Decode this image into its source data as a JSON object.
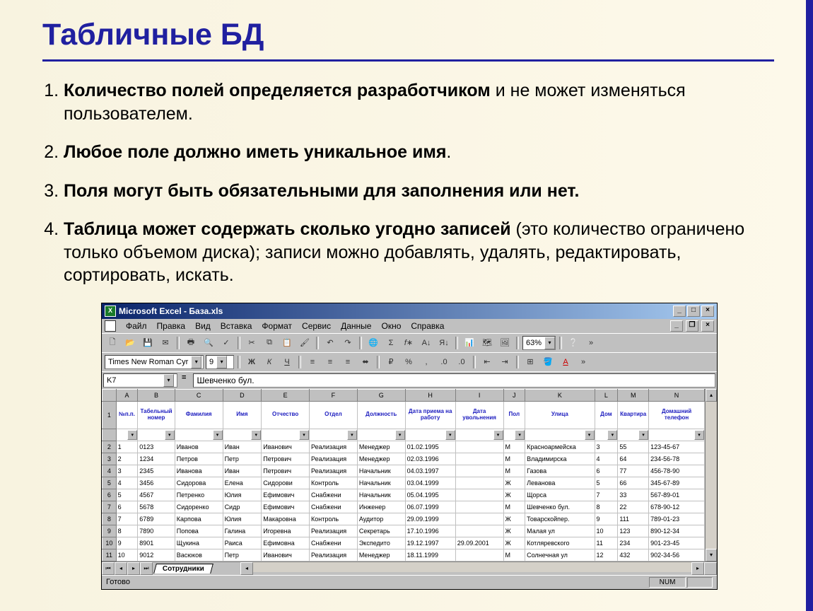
{
  "slide": {
    "title": "Табличные БД",
    "points": [
      {
        "bold": "Количество полей определяется разработчиком",
        "rest": " и не может изменяться пользователем."
      },
      {
        "bold": "Любое поле должно иметь уникальное имя",
        "rest": "."
      },
      {
        "bold": "Поля могут быть обязательными для заполнения или нет.",
        "rest": ""
      },
      {
        "bold": "Таблица может содержать сколько угодно записей",
        "rest": " (это количество ограничено только объемом диска); записи можно добавлять, удалять, редактировать, сортировать, искать."
      }
    ]
  },
  "excel": {
    "title": "Microsoft Excel - База.xls",
    "menu": [
      "Файл",
      "Правка",
      "Вид",
      "Вставка",
      "Формат",
      "Сервис",
      "Данные",
      "Окно",
      "Справка"
    ],
    "font": "Times New Roman Cyr",
    "fontsize": "9",
    "zoom": "63%",
    "namebox": "K7",
    "formula": "Шевченко бул.",
    "cols": [
      "A",
      "B",
      "C",
      "D",
      "E",
      "F",
      "G",
      "H",
      "I",
      "J",
      "K",
      "L",
      "M",
      "N"
    ],
    "headers": [
      "№п.п.",
      "Табельный номер",
      "Фамилия",
      "Имя",
      "Отчество",
      "Отдел",
      "Должность",
      "Дата приема на работу",
      "Дата увольнения",
      "Пол",
      "Улица",
      "Дом",
      "Квартира",
      "Домашний телефон"
    ],
    "rows": [
      [
        "1",
        "0123",
        "Иванов",
        "Иван",
        "Иванович",
        "Реализация",
        "Менеджер",
        "01.02.1995",
        "",
        "М",
        "Красноармейска",
        "3",
        "55",
        "123-45-67"
      ],
      [
        "2",
        "1234",
        "Петров",
        "Петр",
        "Петрович",
        "Реализация",
        "Менеджер",
        "02.03.1996",
        "",
        "М",
        "Владимирска",
        "4",
        "64",
        "234-56-78"
      ],
      [
        "3",
        "2345",
        "Иванова",
        "Иван",
        "Петрович",
        "Реализация",
        "Начальник",
        "04.03.1997",
        "",
        "М",
        "Газова",
        "6",
        "77",
        "456-78-90"
      ],
      [
        "4",
        "3456",
        "Сидорова",
        "Елена",
        "Сидорови",
        "Контроль",
        "Начальник",
        "03.04.1999",
        "",
        "Ж",
        "Леванова",
        "5",
        "66",
        "345-67-89"
      ],
      [
        "5",
        "4567",
        "Петренко",
        "Юлия",
        "Ефимович",
        "Снабжени",
        "Начальник",
        "05.04.1995",
        "",
        "Ж",
        "Щорса",
        "7",
        "33",
        "567-89-01"
      ],
      [
        "6",
        "5678",
        "Сидоренко",
        "Сидр",
        "Ефимович",
        "Снабжени",
        "Инженер",
        "06.07.1999",
        "",
        "М",
        "Шевченко бул.",
        "8",
        "22",
        "678-90-12"
      ],
      [
        "7",
        "6789",
        "Карпова",
        "Юлия",
        "Макаровна",
        "Контроль",
        "Аудитор",
        "29.09.1999",
        "",
        "Ж",
        "Товарскойпер.",
        "9",
        "111",
        "789-01-23"
      ],
      [
        "8",
        "7890",
        "Попова",
        "Галина",
        "Игоревна",
        "Реализация",
        "Секретарь",
        "17.10.1996",
        "",
        "Ж",
        "Малая ул",
        "10",
        "123",
        "890-12-34"
      ],
      [
        "9",
        "8901",
        "Щукина",
        "Раиса",
        "Ефимовна",
        "Снабжени",
        "Экспедито",
        "19.12.1997",
        "29.09.2001",
        "Ж",
        "Котляревского",
        "11",
        "234",
        "901-23-45"
      ],
      [
        "10",
        "9012",
        "Васюков",
        "Петр",
        "Иванович",
        "Реализация",
        "Менеджер",
        "18.11.1999",
        "",
        "М",
        "Солнечная ул",
        "12",
        "432",
        "902-34-56"
      ]
    ],
    "sheet": "Сотрудники",
    "status": "Готово",
    "numlock": "NUM"
  }
}
